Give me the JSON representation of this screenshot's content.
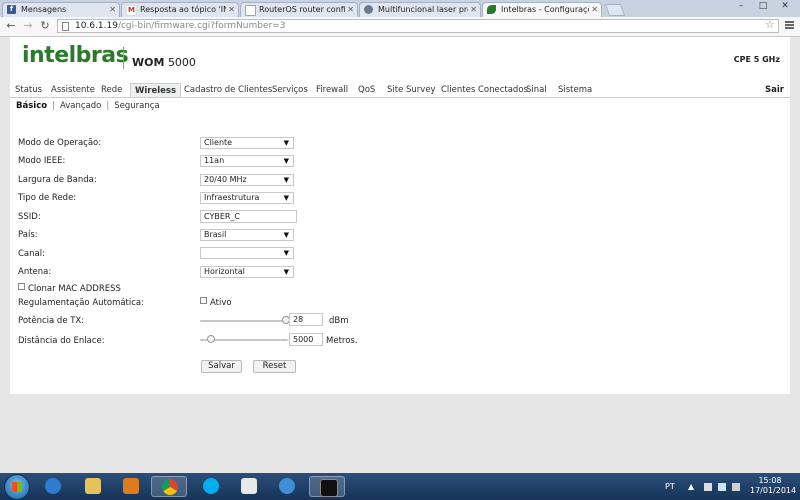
{
  "browser": {
    "tabs": [
      {
        "label": "Mensagens",
        "favicon": "facebook-icon",
        "color": "#3b5998",
        "active": false
      },
      {
        "label": "Resposta ao tópico 'INTEL",
        "favicon": "gmail-icon",
        "color": "#d93025",
        "active": false
      },
      {
        "label": "RouterOS router configura",
        "favicon": "page-icon",
        "color": "#9aa4ad",
        "active": false
      },
      {
        "label": "Multifuncional laser pro M",
        "favicon": "globe-icon",
        "color": "#6a7a8a",
        "active": false
      },
      {
        "label": "Intelbras - Configurações",
        "favicon": "intelbras-leaf-icon",
        "color": "#2a7a2a",
        "active": true
      }
    ],
    "url_host": "10.6.1.19",
    "url_path": "/cgi-bin/firmware.cgi?formNumber=3"
  },
  "header": {
    "logo": "intelbras",
    "model_prefix": "WOM",
    "model_number": "5000",
    "band": "CPE 5 GHz"
  },
  "menu": {
    "items": [
      "Status",
      "Assistente",
      "Rede",
      "Wireless",
      "Cadastro de Clientes",
      "Serviços",
      "Firewall",
      "QoS",
      "Site Survey",
      "Clientes Conectados",
      "Sinal",
      "Sistema"
    ],
    "selected": "Wireless",
    "logout": "Sair"
  },
  "submenu": {
    "items": [
      "Básico",
      "Avançado",
      "Segurança"
    ],
    "selected": "Básico"
  },
  "form": {
    "modo_operacao": {
      "label": "Modo de Operação:",
      "value": "Cliente"
    },
    "modo_ieee": {
      "label": "Modo IEEE:",
      "value": "11an"
    },
    "largura_banda": {
      "label": "Largura de Banda:",
      "value": "20/40 MHz"
    },
    "tipo_rede": {
      "label": "Tipo de Rede:",
      "value": "Infraestrutura"
    },
    "ssid": {
      "label": "SSID:",
      "value": "CYBER_C"
    },
    "pais": {
      "label": "País:",
      "value": "Brasil"
    },
    "canal": {
      "label": "Canal:",
      "value": ""
    },
    "antena": {
      "label": "Antena:",
      "value": "Horizontal"
    },
    "clonar_mac": {
      "label": "Clonar MAC ADDRESS",
      "checked": false
    },
    "regulamentacao": {
      "label": "Regulamentação Automática:",
      "option": "Ativo",
      "checked": false
    },
    "potencia_tx": {
      "label": "Potência de TX:",
      "value": "28",
      "unit": "dBm",
      "slider_fraction": 0.98
    },
    "distancia_enlace": {
      "label": "Distância do Enlace:",
      "value": "5000",
      "unit": "Metros.",
      "slider_fraction": 0.12
    },
    "save_label": "Salvar",
    "reset_label": "Reset"
  },
  "taskbar": {
    "language": "PT",
    "time": "15:08",
    "date": "17/01/2014"
  }
}
